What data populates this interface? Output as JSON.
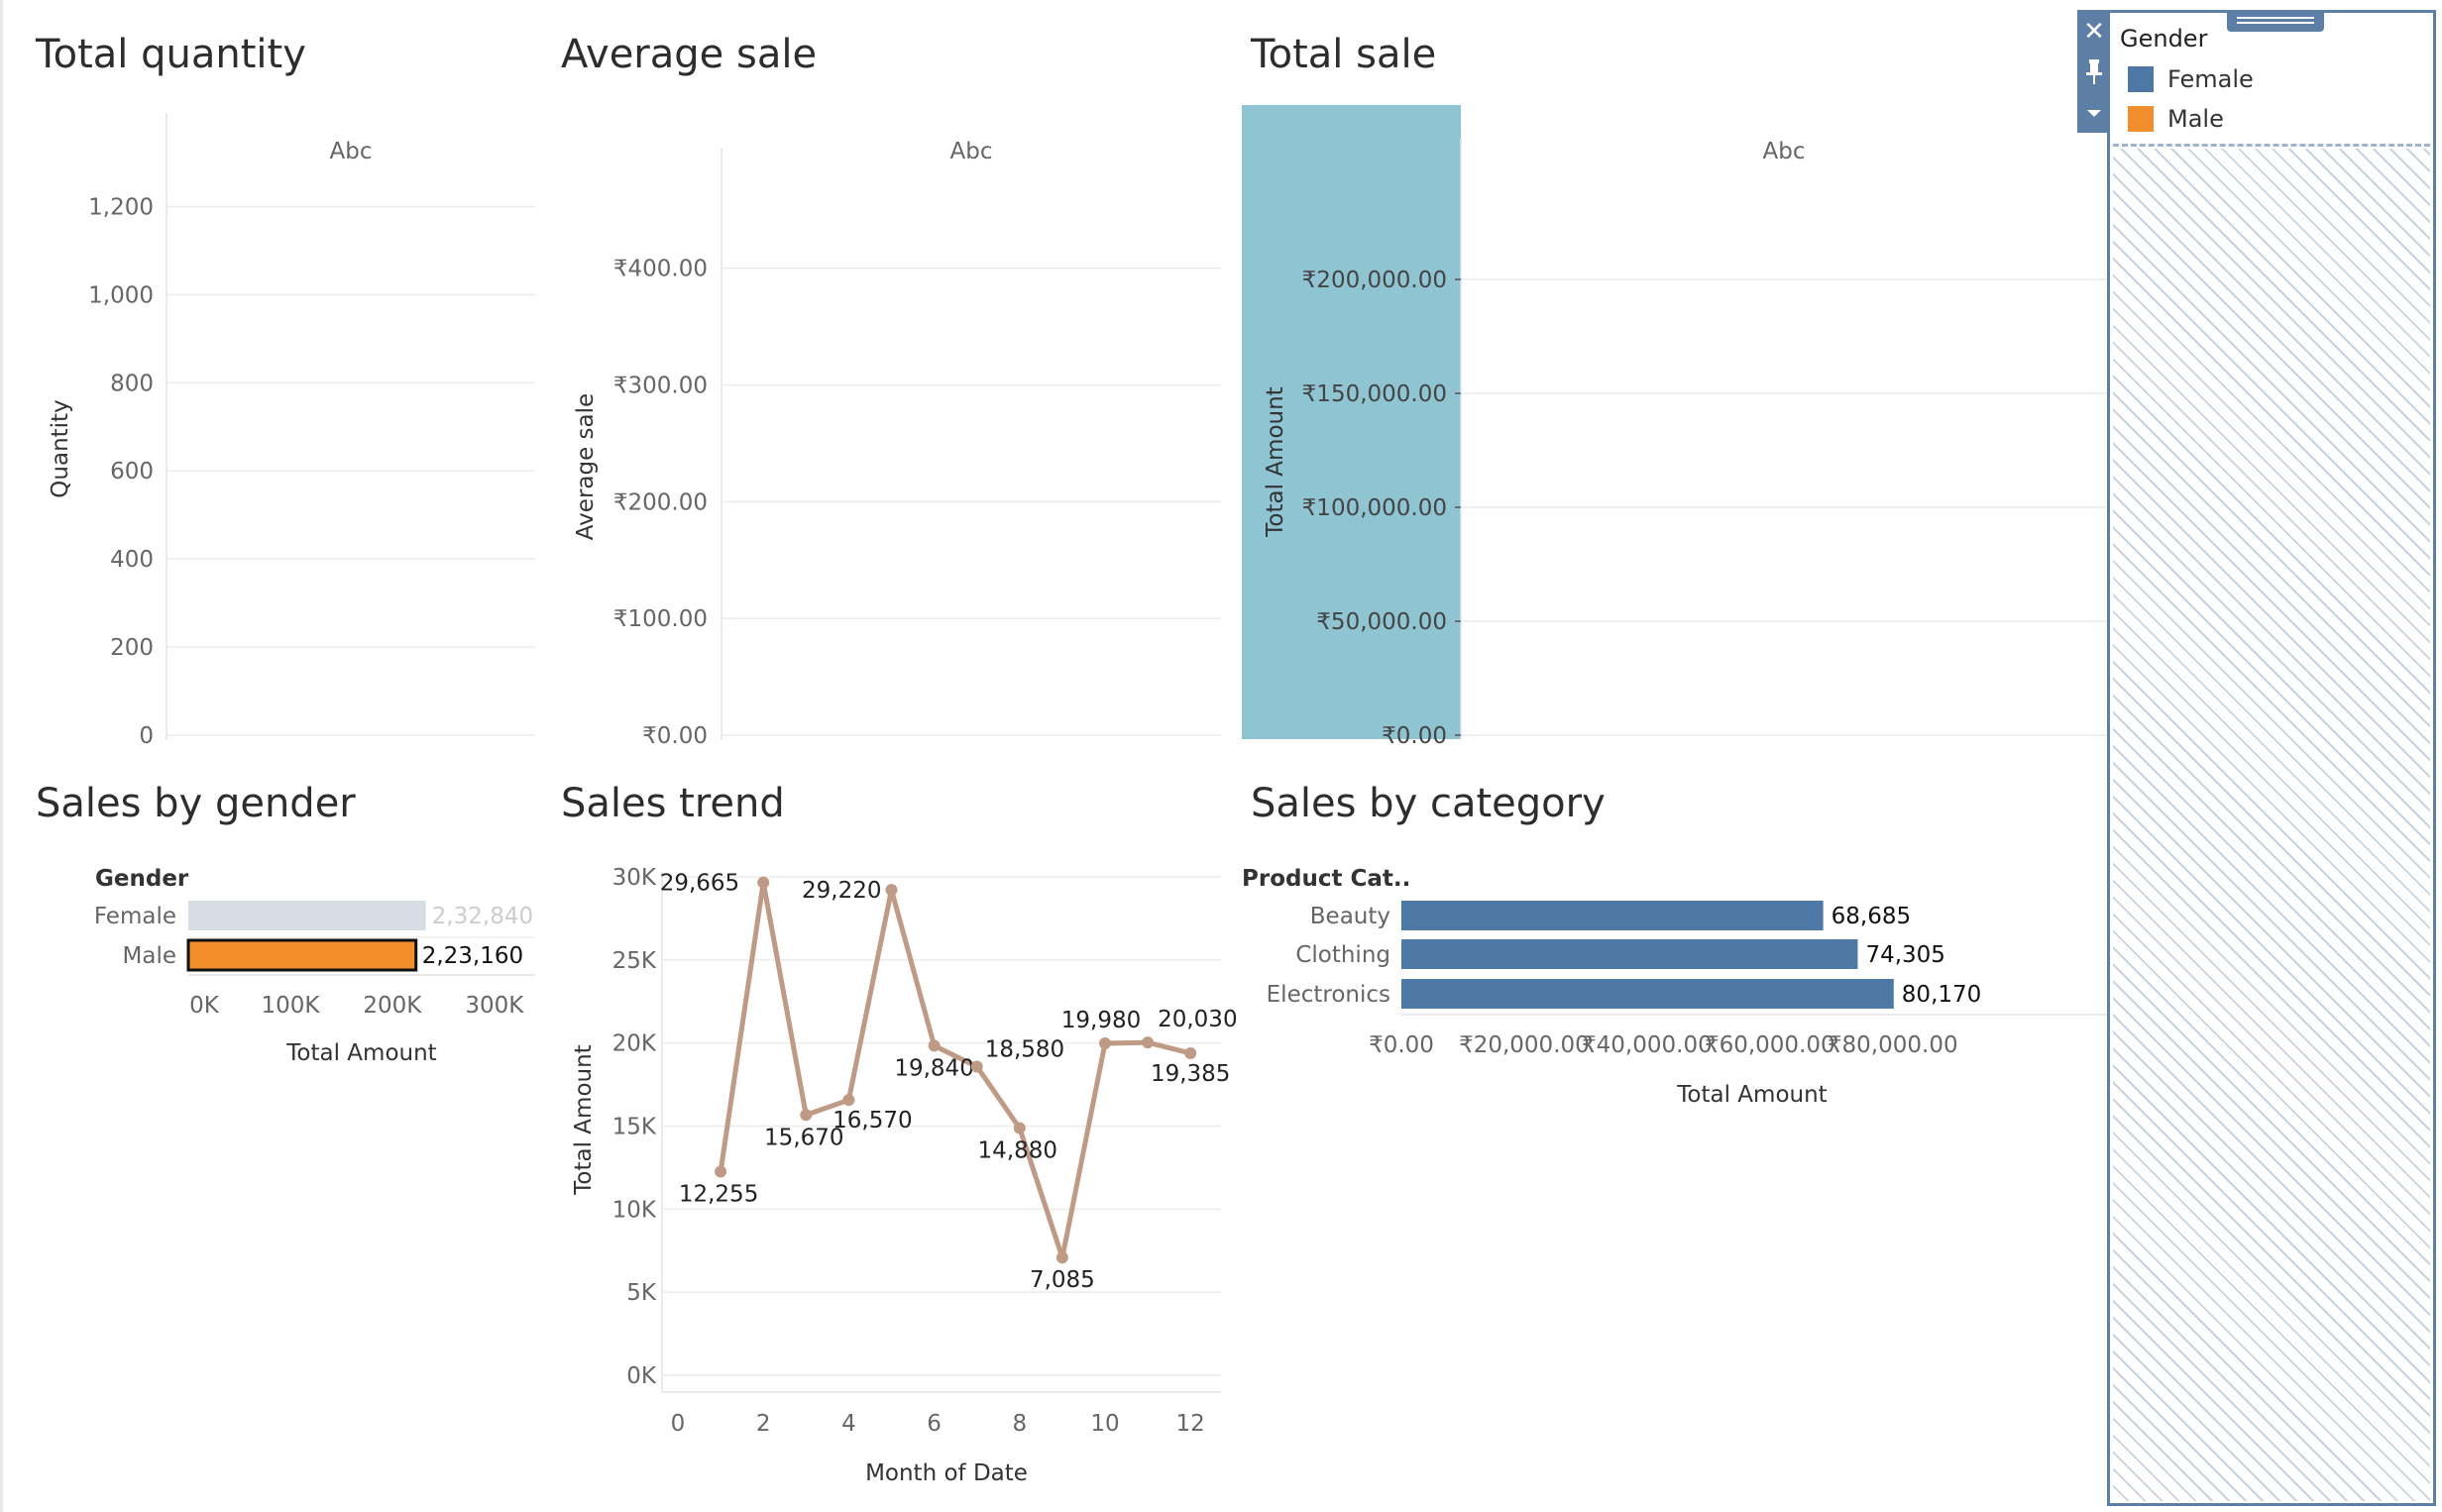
{
  "colors": {
    "female": "#4e79a7",
    "male": "#f28e2b",
    "female_dimmed": "#d7dce4",
    "trend_line": "#bf9a84",
    "category_bar": "#4e79a7",
    "total_sale_highlight": "#8fc5d3",
    "legend_border": "#5e7fa5",
    "grid": "#ececec"
  },
  "legend": {
    "title": "Gender",
    "items": [
      {
        "label": "Female",
        "color": "#4e79a7"
      },
      {
        "label": "Male",
        "color": "#f28e2b"
      }
    ],
    "tools": [
      "close-icon",
      "pin-icon",
      "dropdown-arrow-icon"
    ]
  },
  "sheets": {
    "total_quantity": {
      "title": "Total quantity"
    },
    "average_sale": {
      "title": "Average sale"
    },
    "total_sale": {
      "title": "Total sale"
    },
    "sales_by_gender": {
      "title": "Sales by gender"
    },
    "sales_trend": {
      "title": "Sales trend"
    },
    "sales_by_category": {
      "title": "Sales by category"
    }
  },
  "chart_data": [
    {
      "id": "total_quantity",
      "type": "bar",
      "title": "Total quantity",
      "categories": [
        "Abc"
      ],
      "values": [],
      "column_header": "Abc",
      "ylabel": "Quantity",
      "ylim": [
        0,
        1300
      ],
      "yticks": [
        0,
        200,
        400,
        600,
        800,
        1000,
        1200
      ],
      "ytick_labels": [
        "0",
        "200",
        "400",
        "600",
        "800",
        "1,000",
        "1,200"
      ],
      "grid": true
    },
    {
      "id": "average_sale",
      "type": "bar",
      "title": "Average sale",
      "categories": [
        "Abc"
      ],
      "values": [],
      "column_header": "Abc",
      "ylabel": "Average sale",
      "ylim": [
        0,
        460
      ],
      "yticks": [
        0,
        100,
        200,
        300,
        400
      ],
      "ytick_labels": [
        "₹0.00",
        "₹100.00",
        "₹200.00",
        "₹300.00",
        "₹400.00"
      ],
      "grid": true
    },
    {
      "id": "total_sale",
      "type": "bar",
      "title": "Total sale",
      "categories": [
        "Abc"
      ],
      "values": [],
      "column_header": "Abc",
      "ylabel": "Total Amount",
      "ylim": [
        0,
        240000
      ],
      "yticks": [
        0,
        50000,
        100000,
        150000,
        200000
      ],
      "ytick_labels": [
        "₹0.00",
        "₹50,000.00",
        "₹100,000.00",
        "₹150,000.00",
        "₹200,000.00"
      ],
      "axis_highlighted": true,
      "grid": true
    },
    {
      "id": "sales_by_gender",
      "type": "bar",
      "orientation": "horizontal",
      "title": "Sales by gender",
      "row_header": "Gender",
      "categories": [
        "Female",
        "Male"
      ],
      "values": [
        232840,
        223160
      ],
      "value_labels": [
        "2,32,840",
        "2,23,160"
      ],
      "selected": "Male",
      "xlabel": "Total Amount",
      "xlim": [
        0,
        340000
      ],
      "xticks": [
        0,
        100000,
        200000,
        300000
      ],
      "xtick_labels": [
        "0K",
        "100K",
        "200K",
        "300K"
      ]
    },
    {
      "id": "sales_trend",
      "type": "line",
      "title": "Sales trend",
      "x": [
        1,
        2,
        3,
        4,
        5,
        6,
        7,
        8,
        9,
        10,
        11,
        12
      ],
      "values": [
        12255,
        29665,
        15670,
        16570,
        29220,
        19840,
        18580,
        14880,
        7085,
        19980,
        20030,
        19385
      ],
      "value_labels": [
        "12,255",
        "29,665",
        "15,670",
        "16,570",
        "29,220",
        "19,840",
        "18,580",
        "14,880",
        "7,085",
        "19,980",
        "20,030",
        "19,385"
      ],
      "xlabel": "Month of Date",
      "ylabel": "Total Amount",
      "xlim": [
        0,
        12.9
      ],
      "ylim": [
        0,
        30000
      ],
      "xticks": [
        0,
        2,
        4,
        6,
        8,
        10,
        12
      ],
      "xtick_labels": [
        "0",
        "2",
        "4",
        "6",
        "8",
        "10",
        "12"
      ],
      "yticks": [
        0,
        5000,
        10000,
        15000,
        20000,
        25000,
        30000
      ],
      "ytick_labels": [
        "0K",
        "5K",
        "10K",
        "15K",
        "20K",
        "25K",
        "30K"
      ],
      "grid": true
    },
    {
      "id": "sales_by_category",
      "type": "bar",
      "orientation": "horizontal",
      "title": "Sales by category",
      "row_header": "Product Cat..",
      "categories": [
        "Beauty",
        "Clothing",
        "Electronics"
      ],
      "values": [
        68685,
        74305,
        80170
      ],
      "value_labels": [
        "68,685",
        "74,305",
        "80,170"
      ],
      "xlabel": "Total Amount",
      "xlim": [
        0,
        89000
      ],
      "xticks": [
        0,
        20000,
        40000,
        60000,
        80000
      ],
      "xtick_labels": [
        "₹0.00",
        "₹20,000.00",
        "₹40,000.00",
        "₹60,000.00",
        "₹80,000.00"
      ]
    }
  ]
}
